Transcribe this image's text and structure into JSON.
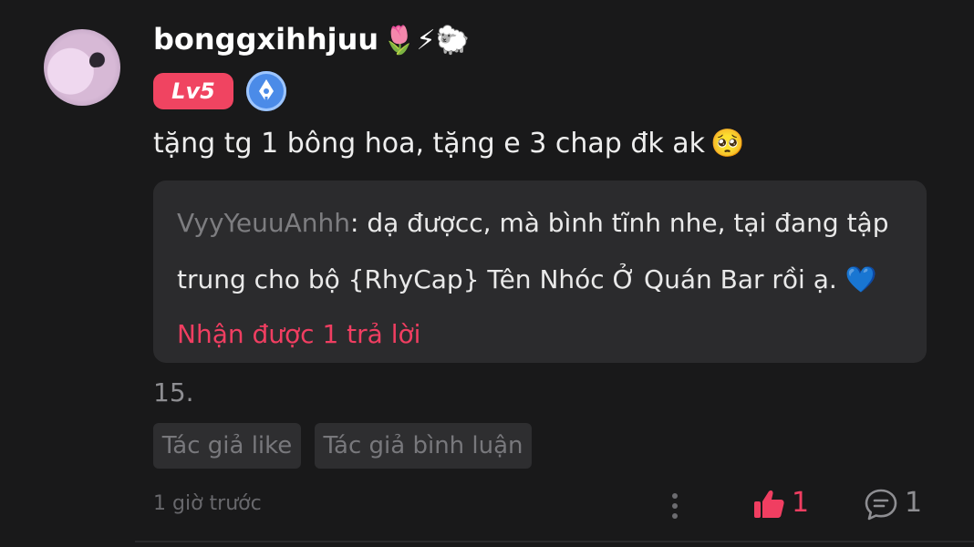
{
  "comment": {
    "username": "bonggxihhjuu",
    "username_emojis": "🌷⚡🐑",
    "level_badge": "Lv5",
    "text": "tặng tg 1 bông hoa, tặng e 3 chap đk ak",
    "text_emoji": "🥺",
    "chapter": "15.",
    "timestamp": "1 giờ trước",
    "like_count": "1",
    "reply_count_icon": "1"
  },
  "reply": {
    "user": "VyyYeuuAnhh",
    "line1": ": dạ đượcc, mà bình tĩnh nhe, tại đang tập",
    "line2": "trung cho bộ {RhyCap} Tên Nhóc Ở Quán Bar rồi ạ.",
    "heart": "💙",
    "replies_label": "Nhận được 1 trả lời"
  },
  "tags": [
    "Tác giả like",
    "Tác giả bình luận"
  ],
  "colors": {
    "background": "#19191a",
    "accent": "#f03e61",
    "reply_box": "#2b2b2d",
    "badge_blue": "#4b8be8"
  },
  "icons": {
    "level": "level-badge",
    "author": "pen-badge-icon",
    "more": "more-vertical-icon",
    "like": "thumbs-up-icon",
    "comment": "comment-bubble-icon"
  }
}
